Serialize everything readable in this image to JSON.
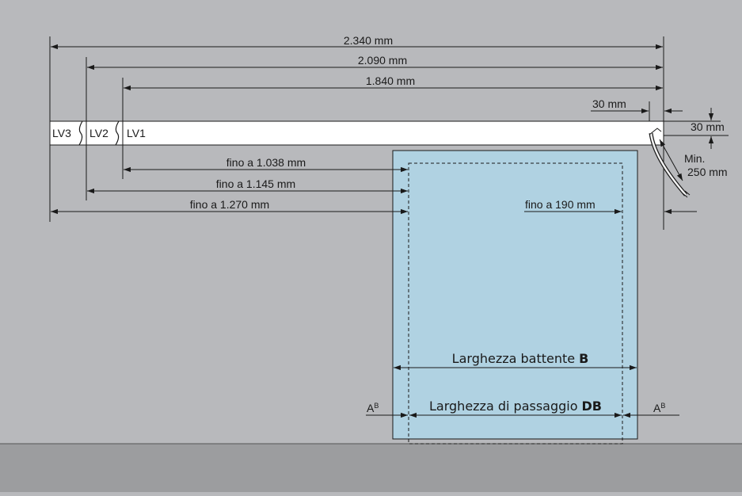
{
  "colors": {
    "background": "#b8b9bc",
    "floor": "#9c9d9f",
    "door_leaf": "#b0d2e2",
    "rail": "#ffffff",
    "ink": "#1a1a1a"
  },
  "rail": {
    "sections": [
      "LV3",
      "LV2",
      "LV1"
    ]
  },
  "dimensions": {
    "total_lv3": "2.340 mm",
    "total_lv2": "2.090 mm",
    "total_lv1": "1.840 mm",
    "cable_offset": "30 mm",
    "cable_height": "30 mm",
    "cable_min_label": "Min.",
    "cable_min_value": "250 mm",
    "upto_lv1": "fino a 1.038 mm",
    "upto_lv2": "fino a 1.145 mm",
    "upto_lv3": "fino a 1.270 mm",
    "upto_right": "fino a 190 mm"
  },
  "door": {
    "leaf_width_label": "Larghezza battente",
    "leaf_width_symbol": "B",
    "passage_width_label": "Larghezza di passaggio",
    "passage_width_symbol": "DB",
    "side_label": "A",
    "side_sup": "B"
  }
}
